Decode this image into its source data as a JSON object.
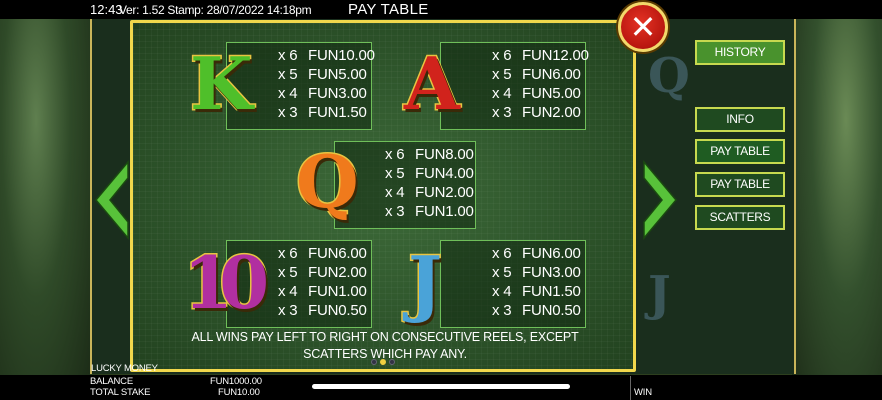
{
  "status": {
    "clock": "12:43",
    "version_stamp": "Ver: 1.52 Stamp: 28/07/2022 14:18pm"
  },
  "paytable": {
    "title": "PAY TABLE",
    "symbols": [
      {
        "name": "K",
        "rows": [
          {
            "mult": "x 6",
            "pay": "FUN10.00"
          },
          {
            "mult": "x 5",
            "pay": "FUN5.00"
          },
          {
            "mult": "x 4",
            "pay": "FUN3.00"
          },
          {
            "mult": "x 3",
            "pay": "FUN1.50"
          }
        ]
      },
      {
        "name": "A",
        "rows": [
          {
            "mult": "x 6",
            "pay": "FUN12.00"
          },
          {
            "mult": "x 5",
            "pay": "FUN6.00"
          },
          {
            "mult": "x 4",
            "pay": "FUN5.00"
          },
          {
            "mult": "x 3",
            "pay": "FUN2.00"
          }
        ]
      },
      {
        "name": "Q",
        "rows": [
          {
            "mult": "x 6",
            "pay": "FUN8.00"
          },
          {
            "mult": "x 5",
            "pay": "FUN4.00"
          },
          {
            "mult": "x 4",
            "pay": "FUN2.00"
          },
          {
            "mult": "x 3",
            "pay": "FUN1.00"
          }
        ]
      },
      {
        "name": "10",
        "rows": [
          {
            "mult": "x 6",
            "pay": "FUN6.00"
          },
          {
            "mult": "x 5",
            "pay": "FUN2.00"
          },
          {
            "mult": "x 4",
            "pay": "FUN1.00"
          },
          {
            "mult": "x 3",
            "pay": "FUN0.50"
          }
        ]
      },
      {
        "name": "J",
        "rows": [
          {
            "mult": "x 6",
            "pay": "FUN6.00"
          },
          {
            "mult": "x 5",
            "pay": "FUN3.00"
          },
          {
            "mult": "x 4",
            "pay": "FUN1.50"
          },
          {
            "mult": "x 3",
            "pay": "FUN0.50"
          }
        ]
      }
    ],
    "rule_text": "ALL WINS PAY LEFT TO RIGHT ON CONSECUTIVE REELS, EXCEPT SCATTERS WHICH PAY ANY.",
    "page_count": 3,
    "current_page": 2
  },
  "menu": {
    "history": "HISTORY",
    "info": "INFO",
    "paytable1": "PAY TABLE",
    "paytable2": "PAY TABLE",
    "scatters": "SCATTERS"
  },
  "footer": {
    "game_name": "LUCKY MONEY",
    "balance_label": "BALANCE",
    "balance_value": "FUN1000.00",
    "stake_label": "TOTAL STAKE",
    "stake_value": "FUN10.00",
    "win_label": "WIN"
  },
  "icons": {
    "close": "close-icon",
    "prev": "chevron-left-icon",
    "next": "chevron-right-icon"
  },
  "colors": {
    "panel_border": "#f1d84c",
    "menu_border": "#c7d94f",
    "close_red": "#d42a1e"
  }
}
